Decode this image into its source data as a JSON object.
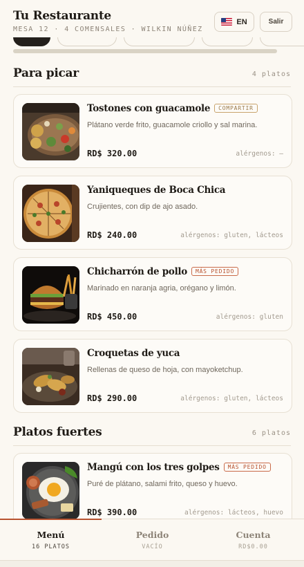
{
  "header": {
    "brand": "Tu Restaurante",
    "subline": "MESA 12 · 4 COMENSALES · WILKIN NÚÑEZ",
    "language_label": "EN",
    "language_flag_icon": "us-flag-icon",
    "logout_label": "Salir"
  },
  "sections": [
    {
      "title": "Para picar",
      "count": "4 platos",
      "dishes": [
        {
          "name": "Tostones con guacamole",
          "badge": "COMPARTIR",
          "badge_type": "share",
          "description": "Plátano verde frito, guacamole criollo y sal marina.",
          "price": "RD$ 320.00",
          "allergens": "alérgenos: —"
        },
        {
          "name": "Yaniqueques de Boca Chica",
          "badge": "",
          "badge_type": "",
          "description": "Crujientes, con dip de ajo asado.",
          "price": "RD$ 240.00",
          "allergens": "alérgenos: gluten, lácteos"
        },
        {
          "name": "Chicharrón de pollo",
          "badge": "MÁS PEDIDO",
          "badge_type": "popular",
          "description": "Marinado en naranja agria, orégano y limón.",
          "price": "RD$ 450.00",
          "allergens": "alérgenos: gluten"
        },
        {
          "name": "Croquetas de yuca",
          "badge": "",
          "badge_type": "",
          "description": "Rellenas de queso de hoja, con mayoketchup.",
          "price": "RD$ 290.00",
          "allergens": "alérgenos: gluten, lácteos"
        }
      ]
    },
    {
      "title": "Platos fuertes",
      "count": "6 platos",
      "dishes": [
        {
          "name": "Mangú con los tres golpes",
          "badge": "MÁS PEDIDO",
          "badge_type": "popular",
          "description": "Puré de plátano, salami frito, queso y huevo.",
          "price": "RD$ 390.00",
          "allergens": "alérgenos: lácteos, huevo"
        }
      ]
    }
  ],
  "tabs": [
    {
      "label": "Menú",
      "sub": "16 PLATOS",
      "active": true
    },
    {
      "label": "Pedido",
      "sub": "VACÍO",
      "active": false
    },
    {
      "label": "Cuenta",
      "sub": "RD$0.00",
      "active": false
    }
  ],
  "colors": {
    "background": "#fbf8f2",
    "accent": "#b8522f",
    "share_badge": "#9b7a4a",
    "text": "#1f1b16",
    "muted": "#8d8478"
  }
}
